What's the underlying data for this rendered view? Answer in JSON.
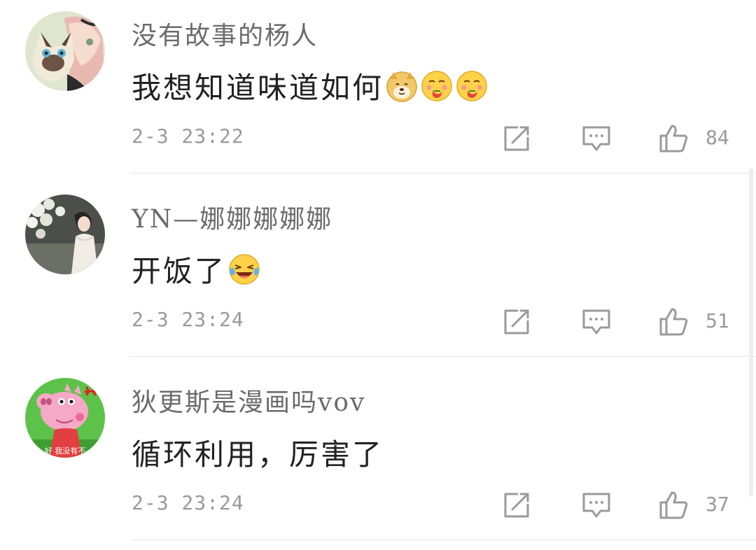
{
  "colors": {
    "background": "#ffffff",
    "username": "#6b6b6b",
    "content": "#222222",
    "meta": "#9a9a9a",
    "divider": "#e6e6e6",
    "icon_stroke": "#9a9a9a"
  },
  "comments": [
    {
      "username": "没有故事的杨人",
      "avatar": "anime-girl-with-siamese-cat",
      "text": "我想知道味道如何",
      "emojis": [
        "doge-emoji",
        "yummy-emoji",
        "yummy-emoji"
      ],
      "timestamp": "2-3 23:22",
      "likes": "84"
    },
    {
      "username": "YN—娜娜娜娜娜",
      "avatar": "woman-under-blossoms",
      "text": "开饭了",
      "emojis": [
        "laugh-cry-emoji"
      ],
      "timestamp": "2-3 23:24",
      "likes": "51"
    },
    {
      "username": "狄更斯是漫画吗vov",
      "avatar": "peppa-pig-angry",
      "avatar_caption": "好 我没有不",
      "text": "循环利用，厉害了",
      "emojis": [],
      "timestamp": "2-3 23:24",
      "likes": "37"
    }
  ],
  "actions": {
    "share_icon": "share-icon",
    "reply_icon": "comment-icon",
    "like_icon": "thumbs-up-icon"
  }
}
